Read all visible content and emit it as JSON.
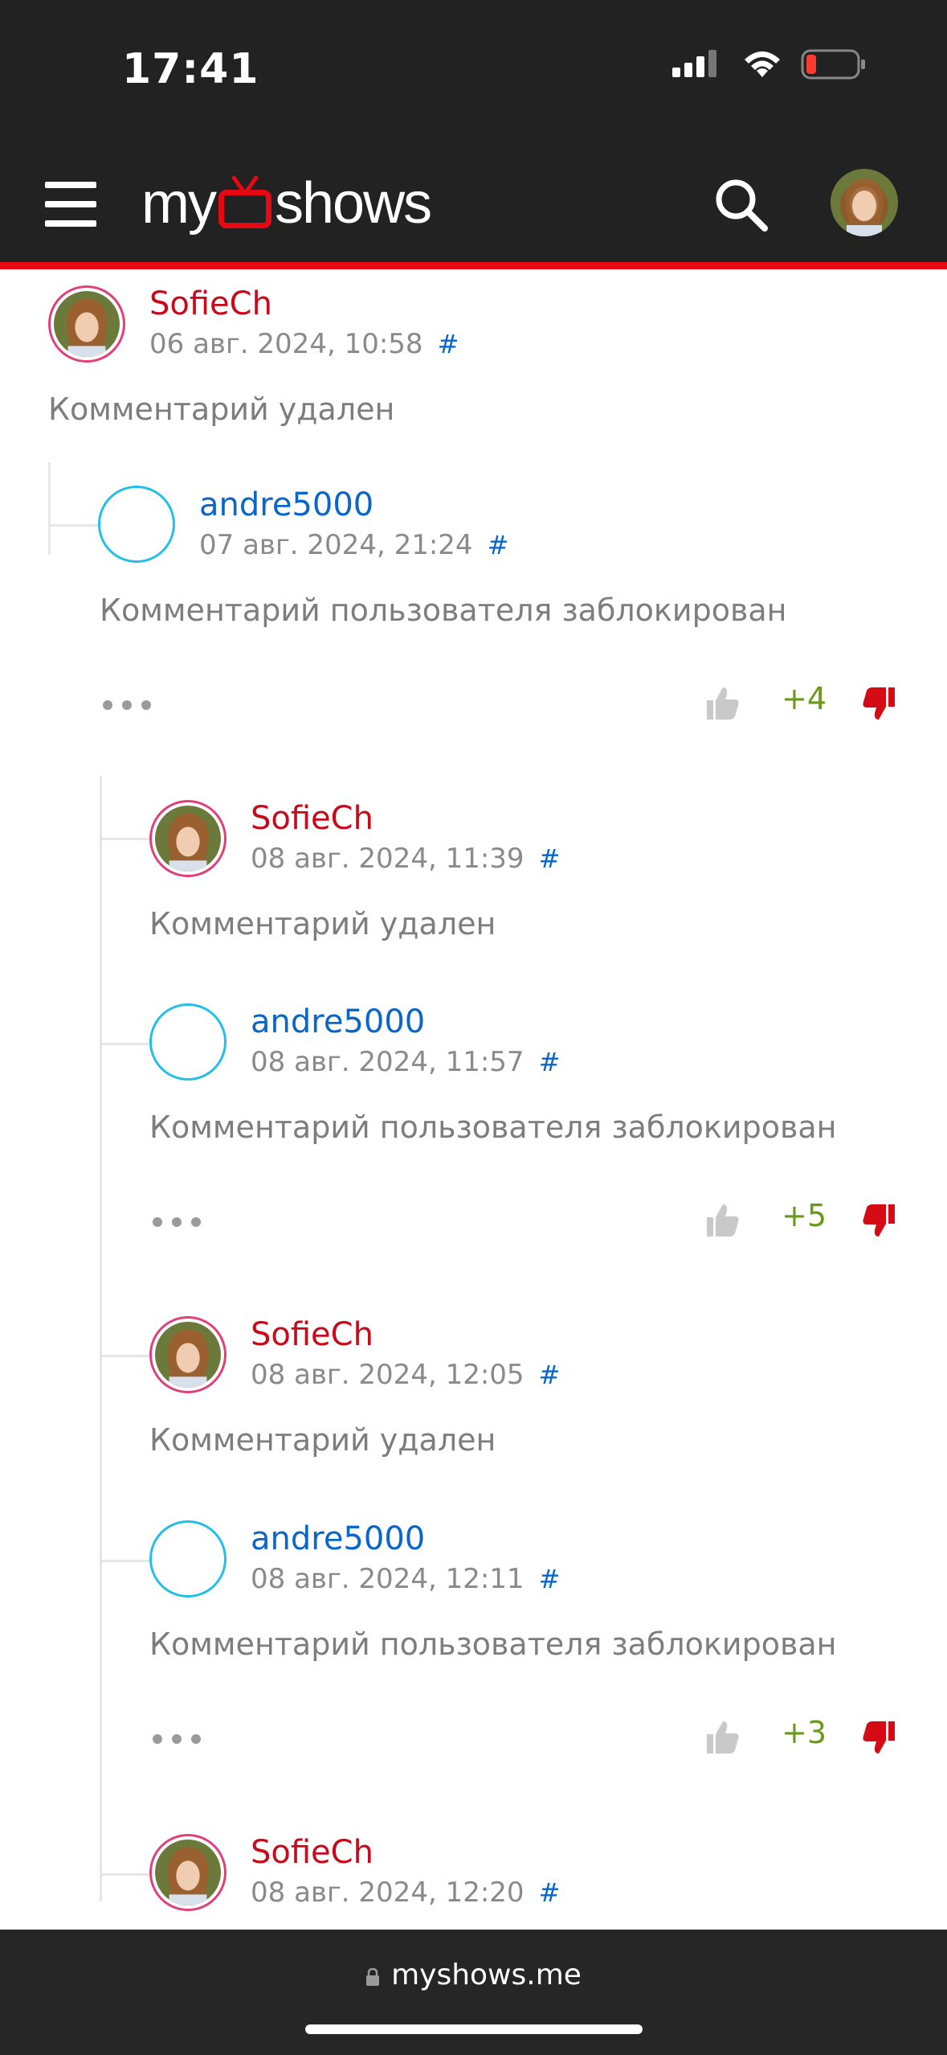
{
  "status_bar": {
    "time": "17:41"
  },
  "header": {
    "logo_text_left": "my",
    "logo_text_right": "shows"
  },
  "comments": [
    {
      "username": "SofieCh",
      "date": "06 авг. 2024, 10:58",
      "hash": "#",
      "text": "Комментарий удален"
    },
    {
      "username": "andre5000",
      "date": "07 авг. 2024, 21:24",
      "hash": "#",
      "text": "Комментарий пользователя заблокирован",
      "score": "+4"
    },
    {
      "username": "SofieCh",
      "date": "08 авг. 2024, 11:39",
      "hash": "#",
      "text": "Комментарий удален"
    },
    {
      "username": "andre5000",
      "date": "08 авг. 2024, 11:57",
      "hash": "#",
      "text": "Комментарий пользователя заблокирован",
      "score": "+5"
    },
    {
      "username": "SofieCh",
      "date": "08 авг. 2024, 12:05",
      "hash": "#",
      "text": "Комментарий удален"
    },
    {
      "username": "andre5000",
      "date": "08 авг. 2024, 12:11",
      "hash": "#",
      "text": "Комментарий пользователя заблокирован",
      "score": "+3"
    },
    {
      "username": "SofieCh",
      "date": "08 авг. 2024, 12:20",
      "hash": "#"
    }
  ],
  "browser": {
    "url": "myshows.me"
  },
  "colors": {
    "accent": "#e50914",
    "username_sofie": "#c8091a",
    "username_andre": "#0a66c8",
    "score": "#6a9a1a",
    "header_bg": "#222222"
  }
}
